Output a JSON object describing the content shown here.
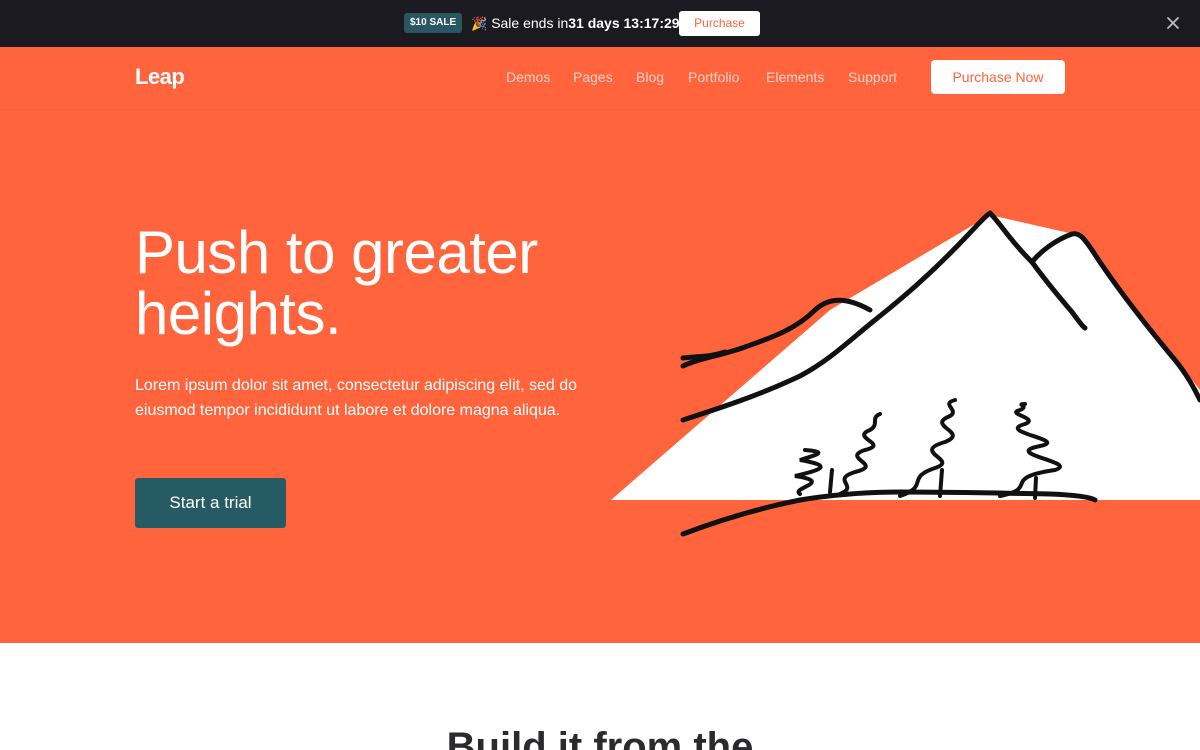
{
  "announcement": {
    "badge": "$10 SALE",
    "party_icon": "party-popper-icon",
    "message": "Sale ends in",
    "timer": "31 days 13:17:29",
    "button": "Purchase",
    "close_icon": "close-icon"
  },
  "nav": {
    "logo": "Leap",
    "links": [
      "Demos",
      "Pages",
      "Blog",
      "Portfolio",
      "Elements",
      "Support"
    ],
    "cta": "Purchase Now"
  },
  "hero": {
    "headline_line1": "Push to greater",
    "headline_line2": "heights.",
    "lead": "Lorem ipsum dolor sit amet, consectetur adipiscing elit, sed do eiusmod tempor incididunt ut labore et dolore magna aliqua.",
    "cta": "Start a trial",
    "illustration": "mountain-illustration"
  },
  "section": {
    "title": "Build it from the"
  },
  "colors": {
    "hero_bg": "#ff643c",
    "topbar_bg": "#1c1a21",
    "badge_bg": "#2a5661",
    "cta_bg": "#275b64"
  }
}
